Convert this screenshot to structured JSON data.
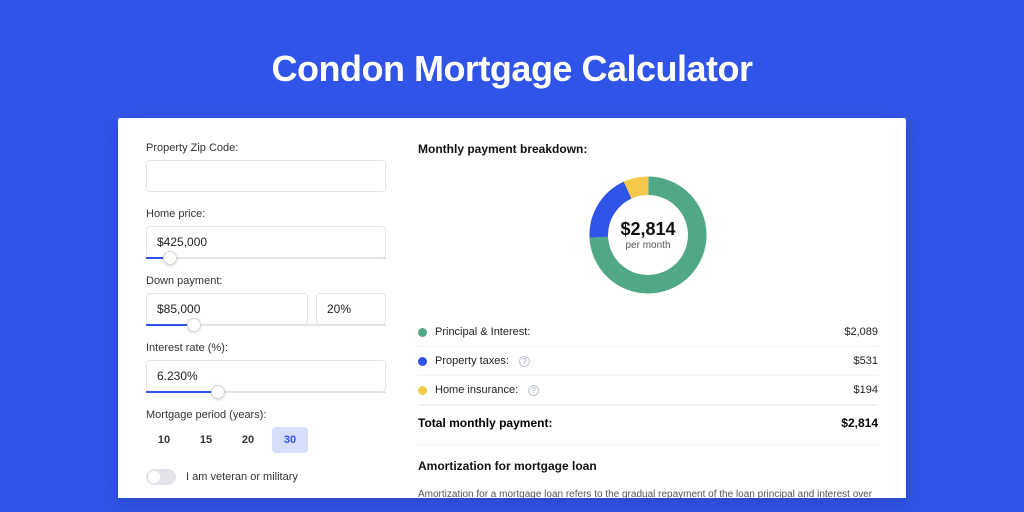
{
  "title": "Condon Mortgage Calculator",
  "form": {
    "zip": {
      "label": "Property Zip Code:",
      "value": ""
    },
    "homePrice": {
      "label": "Home price:",
      "value": "$425,000",
      "slider_pct": 10
    },
    "downPayment": {
      "label": "Down payment:",
      "value": "$85,000",
      "pct": "20%",
      "slider_pct": 20
    },
    "rate": {
      "label": "Interest rate (%):",
      "value": "6.230%",
      "slider_pct": 30
    },
    "period": {
      "label": "Mortgage period (years):",
      "options": [
        "10",
        "15",
        "20",
        "30"
      ],
      "selected": "30"
    },
    "veteran": {
      "label": "I am veteran or military",
      "checked": false
    }
  },
  "breakdown": {
    "title": "Monthly payment breakdown:",
    "center_amount": "$2,814",
    "center_sub": "per month",
    "items": [
      {
        "name": "Principal & Interest:",
        "value": "$2,089",
        "color": "#50a886"
      },
      {
        "name": "Property taxes:",
        "value": "$531",
        "color": "#3154e8",
        "info": true
      },
      {
        "name": "Home insurance:",
        "value": "$194",
        "color": "#f4c94b",
        "info": true
      }
    ],
    "total": {
      "label": "Total monthly payment:",
      "value": "$2,814"
    }
  },
  "amortization": {
    "title": "Amortization for mortgage loan",
    "body": "Amortization for a mortgage loan refers to the gradual repayment of the loan principal and interest over a specified"
  },
  "chart_data": {
    "type": "pie",
    "title": "Monthly payment breakdown",
    "series": [
      {
        "name": "Principal & Interest",
        "value": 2089,
        "color": "#50a886"
      },
      {
        "name": "Property taxes",
        "value": 531,
        "color": "#3154e8"
      },
      {
        "name": "Home insurance",
        "value": 194,
        "color": "#f4c94b"
      }
    ],
    "total": 2814,
    "inner_label": "$2,814 per month"
  }
}
